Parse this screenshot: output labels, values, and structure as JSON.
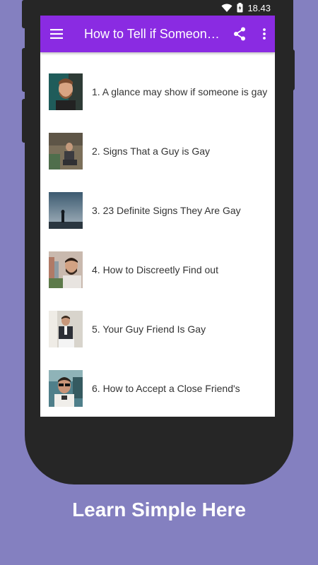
{
  "status_bar": {
    "time": "18.43"
  },
  "toolbar": {
    "title": "How to Tell if Someone is Gay",
    "menu_icon": "hamburger-menu-icon",
    "share_icon": "share-icon",
    "overflow_icon": "more-vert-icon"
  },
  "accent_color": "#8a2be2",
  "items": [
    {
      "label": "1. A glance may show if someone is gay",
      "thumb": "photo-man-beard"
    },
    {
      "label": "2. Signs That a Guy is Gay",
      "thumb": "photo-man-sitting"
    },
    {
      "label": "3. 23 Definite Signs They Are Gay",
      "thumb": "photo-silhouette-sky"
    },
    {
      "label": "4. How to Discreetly Find out",
      "thumb": "photo-man-city"
    },
    {
      "label": "5. Your Guy Friend Is Gay",
      "thumb": "photo-man-suit"
    },
    {
      "label": "6. How to Accept a Close Friend's",
      "thumb": "photo-man-sunglasses"
    }
  ],
  "caption": "Learn Simple Here"
}
